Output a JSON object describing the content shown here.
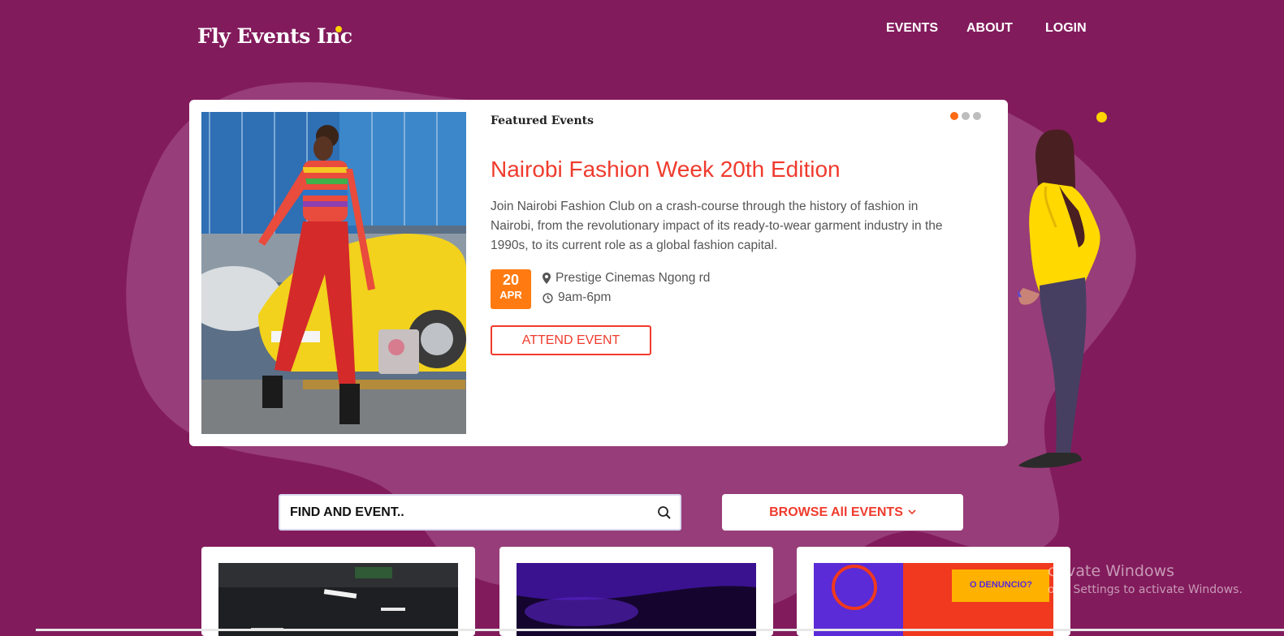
{
  "brand": {
    "name": "Fly Events Inc"
  },
  "nav": {
    "items": [
      "EVENTS",
      "ABOUT",
      "LOGIN"
    ]
  },
  "hero": {
    "kicker": "Featured Events",
    "carousel_slide_count": 3,
    "carousel_active_index": 0,
    "title": "Nairobi Fashion Week 20th Edition",
    "description": "Join Nairobi Fashion Club on a crash-course through the history of fashion in Nairobi, from the revolutionary impact of its ready-to-wear garment industry in the 1990s, to its current role as a global fashion capital.",
    "date_day": "20",
    "date_month": "APR",
    "location": "Prestige Cinemas Ngong rd",
    "time": "9am-6pm",
    "cta": "ATTEND EVENT"
  },
  "search": {
    "value": "FIND AND EVENT..",
    "icon": "search-icon"
  },
  "browse": {
    "label": "BROWSE All EVENTS",
    "icon": "chevron-down-icon"
  },
  "watermark": {
    "line1": "ctivate Windows",
    "line2": "o to Settings to activate Windows."
  },
  "colors": {
    "background": "#821b5c",
    "accent_red": "#ef3b2d",
    "accent_orange": "#ff7b12",
    "brand_dot": "#ffd400"
  }
}
